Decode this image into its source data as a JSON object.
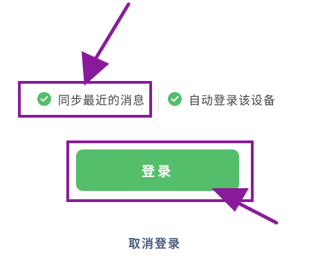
{
  "options": [
    {
      "label": "同步最近的消息",
      "checked": true,
      "icon": "check-circle-icon"
    },
    {
      "label": "自动登录该设备",
      "checked": true,
      "icon": "check-circle-icon"
    }
  ],
  "login_button": {
    "label": "登录"
  },
  "cancel_link": {
    "label": "取消登录"
  },
  "colors": {
    "accent_green": "#54be6a",
    "annotation_purple": "#8a1a9c",
    "link_text": "#4a5d80"
  }
}
